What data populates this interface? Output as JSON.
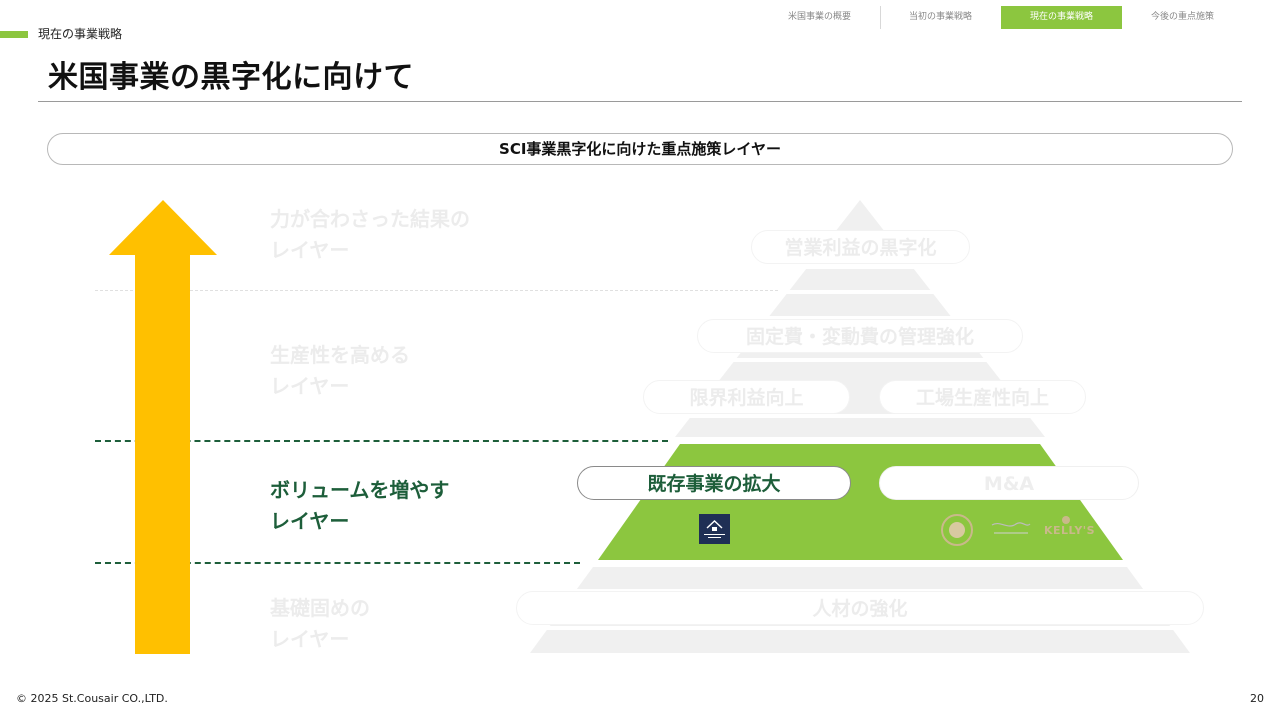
{
  "nav": {
    "tabs": [
      {
        "label": "米国事業の概要",
        "active": false
      },
      {
        "label": "当初の事業戦略",
        "active": false
      },
      {
        "label": "現在の事業戦略",
        "active": true
      },
      {
        "label": "今後の重点施策",
        "active": false
      }
    ]
  },
  "header": {
    "section_label": "現在の事業戦略",
    "title": "米国事業の黒字化に向けて"
  },
  "banner": {
    "text": "SCI事業黒字化に向けた重点施策レイヤー"
  },
  "layers": [
    {
      "line1": "力が合わさった結果の",
      "line2": "レイヤー",
      "active": false
    },
    {
      "line1": "生産性を高める",
      "line2": "レイヤー",
      "active": false
    },
    {
      "line1": "ボリュームを増やす",
      "line2": "レイヤー",
      "active": true
    },
    {
      "line1": "基礎固めの",
      "line2": "レイヤー",
      "active": false
    }
  ],
  "pyramid": {
    "items": {
      "profit": "営業利益の黒字化",
      "cost": "固定費・変動費の管理強化",
      "margin": "限界利益向上",
      "factory": "工場生産性向上",
      "existing": "既存事業の拡大",
      "ma": "M&A",
      "talent": "人材の強化"
    },
    "logos": {
      "kuze": "KUZE FUKU & SONS",
      "kellys": "KELLY'S"
    }
  },
  "colors": {
    "accent_green": "#8cc63f",
    "dark_green": "#1d5e3a",
    "arrow_yellow": "#ffc000",
    "faded_grey": "#f0f0f0"
  },
  "footer": {
    "copyright": "© 2025 St.Cousair CO.,LTD.",
    "page_number": "20"
  }
}
